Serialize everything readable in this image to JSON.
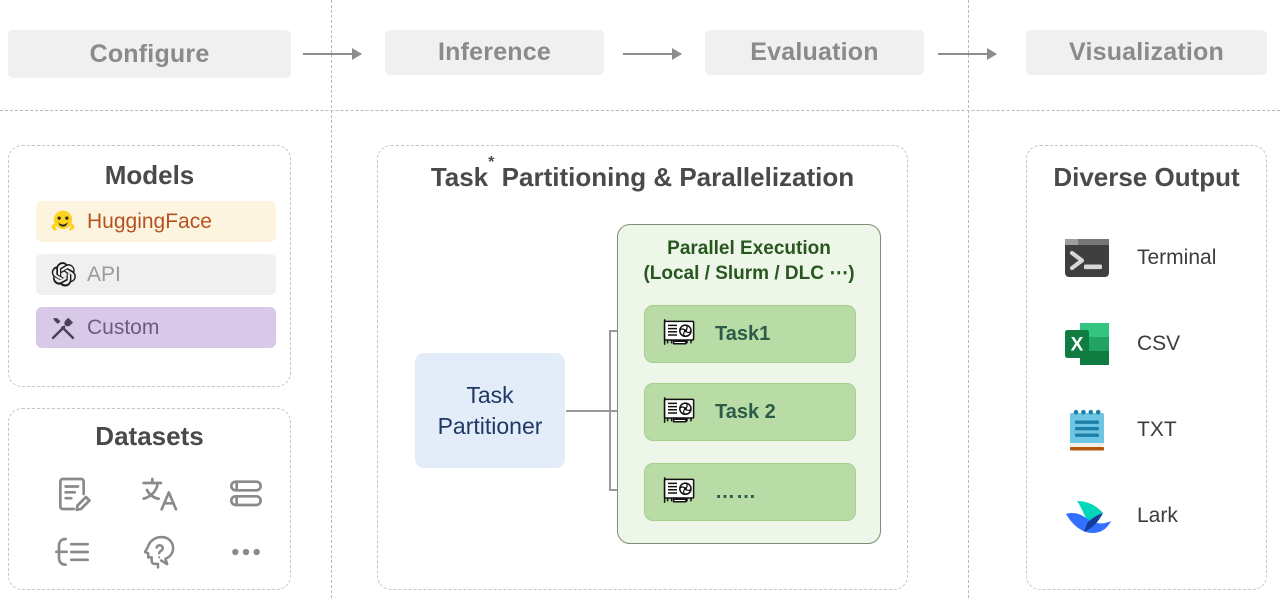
{
  "pipeline": {
    "stages": [
      {
        "label": "Configure"
      },
      {
        "label": "Inference"
      },
      {
        "label": "Evaluation"
      },
      {
        "label": "Visualization"
      }
    ],
    "arrow_name": "pipeline-arrow"
  },
  "models": {
    "title": "Models",
    "items": [
      {
        "label": "HuggingFace",
        "icon": "hugging-face-icon",
        "bg": "#fdf4e0",
        "fg": "#b4531f"
      },
      {
        "label": "API",
        "icon": "openai-icon",
        "bg": "#f0f0f0",
        "fg": "#9a9a9a"
      },
      {
        "label": "Custom",
        "icon": "tools-icon",
        "bg": "#d9c9e8",
        "fg": "#6d5c7d"
      }
    ]
  },
  "datasets": {
    "title": "Datasets",
    "icons": [
      {
        "name": "document-edit-icon"
      },
      {
        "name": "translate-icon"
      },
      {
        "name": "books-stack-icon"
      },
      {
        "name": "math-list-icon"
      },
      {
        "name": "reasoning-head-icon"
      },
      {
        "name": "ellipsis-icon"
      }
    ]
  },
  "center": {
    "title_main": "Task",
    "title_sup": "*",
    "title_rest": " Partitioning & Parallelization",
    "partitioner": {
      "line1": "Task",
      "line2": "Partitioner"
    },
    "parallel": {
      "title_line1": "Parallel Execution",
      "title_line2": "(Local / Slurm / DLC ⋯)",
      "tasks": [
        {
          "label": "Task1",
          "icon": "gpu-card-icon"
        },
        {
          "label": "Task 2",
          "icon": "gpu-card-icon"
        },
        {
          "label": "……",
          "icon": "gpu-card-icon"
        }
      ]
    }
  },
  "outputs": {
    "title": "Diverse Output",
    "items": [
      {
        "label": "Terminal",
        "icon": "terminal-icon"
      },
      {
        "label": "CSV",
        "icon": "excel-csv-icon"
      },
      {
        "label": "TXT",
        "icon": "notepad-txt-icon"
      },
      {
        "label": "Lark",
        "icon": "lark-icon"
      }
    ]
  },
  "colors": {
    "stage_bg": "#f0f0f0",
    "stage_fg": "#8a8a8a",
    "divider": "#b9b9b9",
    "partitioner_bg": "#e3edfa",
    "partitioner_fg": "#1f3864",
    "parallel_bg": "#edf6e8",
    "parallel_fg": "#27571f",
    "task_bg": "#b9dca6",
    "task_fg": "#2d5b4a"
  }
}
